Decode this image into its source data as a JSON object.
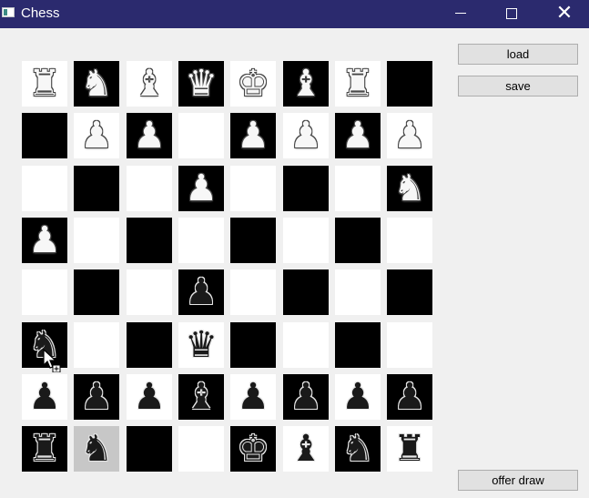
{
  "window": {
    "title": "Chess",
    "icon": "app-window-icon"
  },
  "controls": {
    "minimize_icon": "minimize-icon",
    "maximize_icon": "maximize-icon",
    "close_glyph": "✕"
  },
  "buttons": {
    "load": "load",
    "save": "save",
    "offer_draw": "offer draw"
  },
  "board": {
    "selected_square": "b1",
    "ranks": [
      [
        [
          "w",
          "R"
        ],
        [
          "w",
          "N"
        ],
        [
          "w",
          "B"
        ],
        [
          "w",
          "Q"
        ],
        [
          "w",
          "K"
        ],
        [
          "w",
          "B"
        ],
        [
          "w",
          "R"
        ],
        null
      ],
      [
        null,
        [
          "w",
          "P"
        ],
        [
          "w",
          "P"
        ],
        null,
        [
          "w",
          "P"
        ],
        [
          "w",
          "P"
        ],
        [
          "w",
          "P"
        ],
        [
          "w",
          "P"
        ]
      ],
      [
        null,
        null,
        null,
        [
          "w",
          "P"
        ],
        null,
        null,
        null,
        [
          "w",
          "N"
        ]
      ],
      [
        [
          "w",
          "P"
        ],
        null,
        null,
        null,
        null,
        null,
        null,
        null
      ],
      [
        null,
        null,
        null,
        [
          "b",
          "P"
        ],
        null,
        null,
        null,
        null
      ],
      [
        [
          "b",
          "N"
        ],
        null,
        null,
        [
          "b",
          "Q"
        ],
        null,
        null,
        null,
        null
      ],
      [
        [
          "b",
          "P"
        ],
        [
          "b",
          "P"
        ],
        [
          "b",
          "P"
        ],
        [
          "b",
          "B"
        ],
        [
          "b",
          "P"
        ],
        [
          "b",
          "P"
        ],
        [
          "b",
          "P"
        ],
        [
          "b",
          "P"
        ]
      ],
      [
        [
          "b",
          "R"
        ],
        [
          "b",
          "N"
        ],
        null,
        null,
        [
          "b",
          "K"
        ],
        [
          "b",
          "B"
        ],
        [
          "b",
          "N"
        ],
        [
          "b",
          "R"
        ]
      ]
    ],
    "square_colors": [
      [
        "light",
        "dark",
        "light",
        "dark",
        "light",
        "dark",
        "light",
        "dark"
      ],
      [
        "dark",
        "light",
        "dark",
        "light",
        "dark",
        "light",
        "dark",
        "light"
      ],
      [
        "light",
        "dark",
        "light",
        "dark",
        "light",
        "dark",
        "light",
        "dark"
      ],
      [
        "dark",
        "light",
        "dark",
        "light",
        "dark",
        "light",
        "dark",
        "light"
      ],
      [
        "light",
        "dark",
        "light",
        "dark",
        "light",
        "dark",
        "light",
        "dark"
      ],
      [
        "dark",
        "light",
        "dark",
        "light",
        "dark",
        "light",
        "dark",
        "light"
      ],
      [
        "light",
        "dark",
        "light",
        "dark",
        "light",
        "dark",
        "light",
        "dark"
      ],
      [
        "dark",
        "light",
        "dark",
        "light",
        "dark",
        "light",
        "dark",
        "light"
      ]
    ]
  }
}
